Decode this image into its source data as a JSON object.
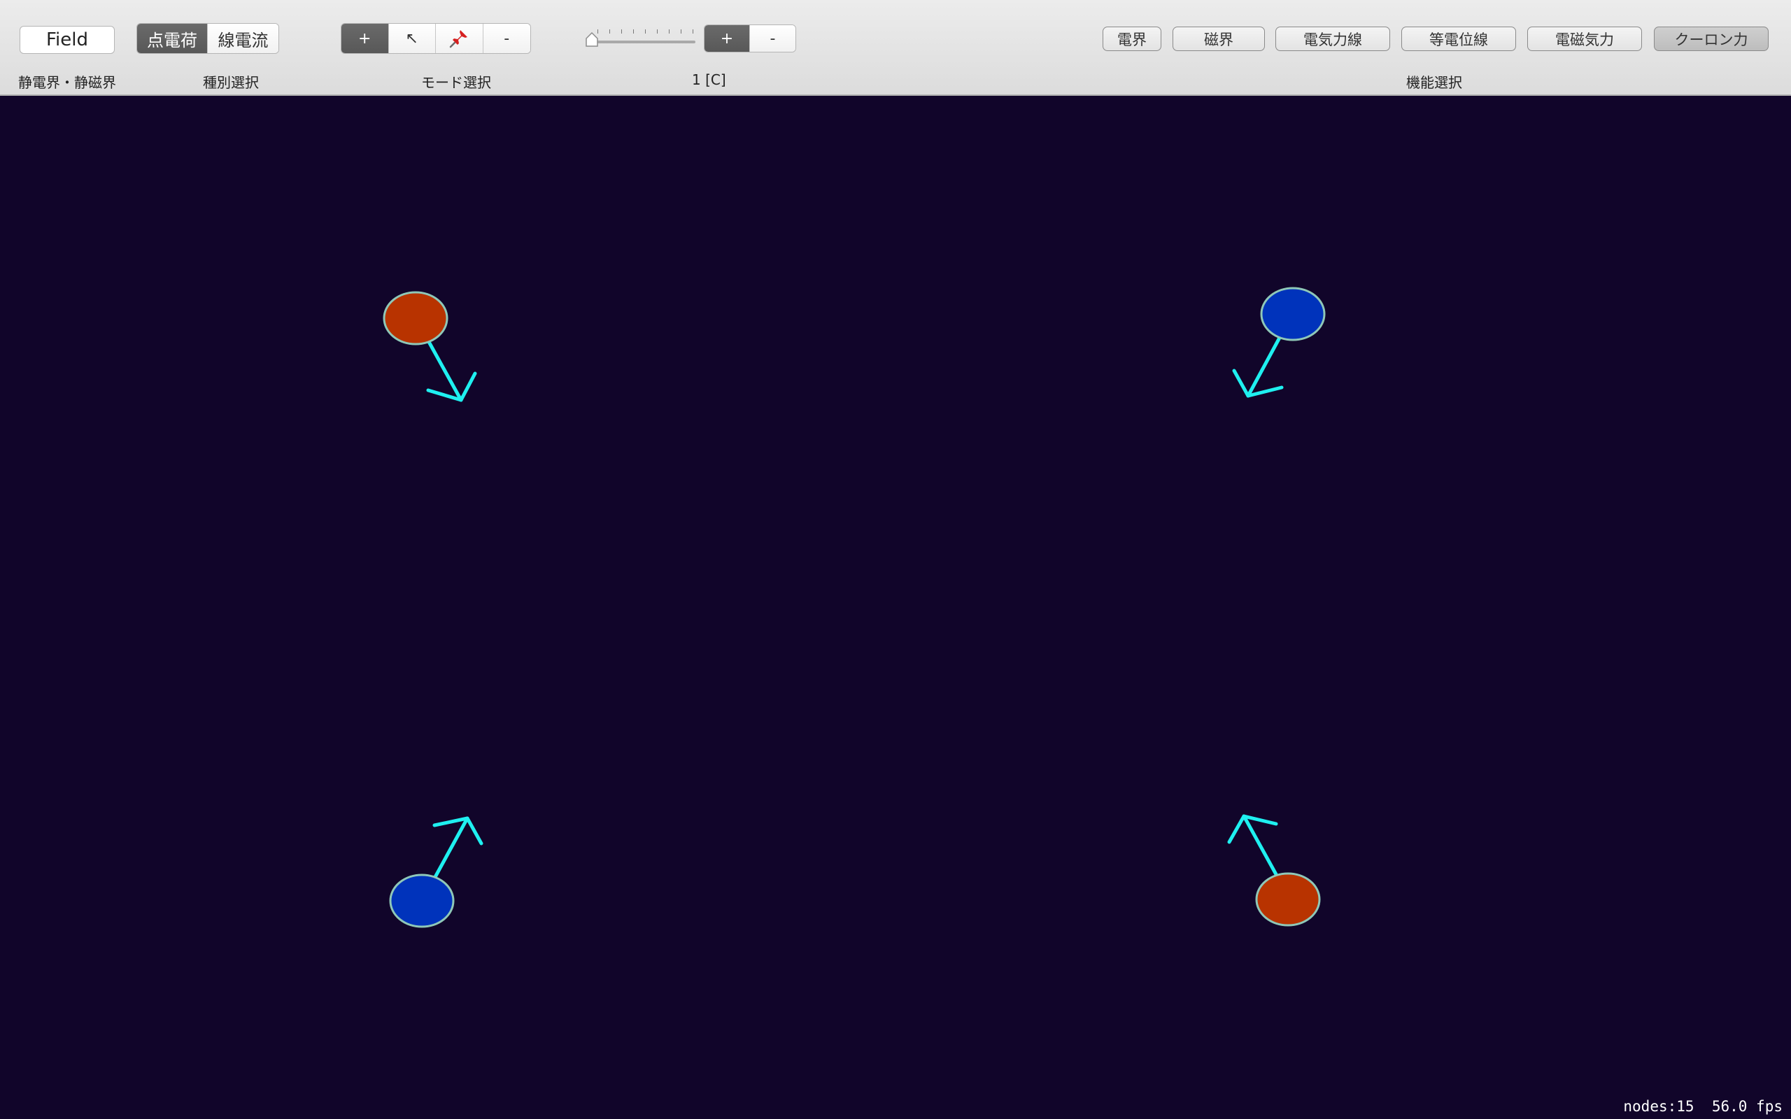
{
  "toolbar": {
    "field_button": "Field",
    "type_segment": [
      {
        "label": "点電荷",
        "active": true
      },
      {
        "label": "線電流",
        "active": false
      }
    ],
    "mode_segment": [
      {
        "label": "+",
        "icon": "plus-icon",
        "active": true
      },
      {
        "label": "↖",
        "icon": "pointer-arrow-icon",
        "active": false
      },
      {
        "label": "📌",
        "icon": "pushpin-icon",
        "active": false
      },
      {
        "label": "-",
        "icon": "minus-icon",
        "active": false
      }
    ],
    "charge_slider_value": 0,
    "sign_segment": [
      {
        "label": "+",
        "active": true
      },
      {
        "label": "-",
        "active": false
      }
    ],
    "function_buttons": [
      {
        "label": "電界",
        "selected": false
      },
      {
        "label": "磁界",
        "selected": false
      },
      {
        "label": "電気力線",
        "selected": false
      },
      {
        "label": "等電位線",
        "selected": false
      },
      {
        "label": "電磁気力",
        "selected": false
      },
      {
        "label": "クーロン力",
        "selected": true
      }
    ]
  },
  "labels": {
    "field_group": "静電界・静磁界",
    "type_group": "種別選択",
    "mode_group": "モード選択",
    "charge_value": "1 [C]",
    "function_group": "機能選択"
  },
  "colors": {
    "background": "#11052a",
    "positive_charge": "#b83300",
    "negative_charge": "#0033bb",
    "charge_outline": "#8fc8b8",
    "force_vector": "#1ff0f0"
  },
  "scene": {
    "charges": [
      {
        "sign": "positive",
        "force_direction": "down-right"
      },
      {
        "sign": "negative",
        "force_direction": "down-left"
      },
      {
        "sign": "negative",
        "force_direction": "up-right"
      },
      {
        "sign": "positive",
        "force_direction": "up-left"
      }
    ]
  },
  "status": {
    "nodes": "nodes:15",
    "fps": "56.0 fps"
  }
}
